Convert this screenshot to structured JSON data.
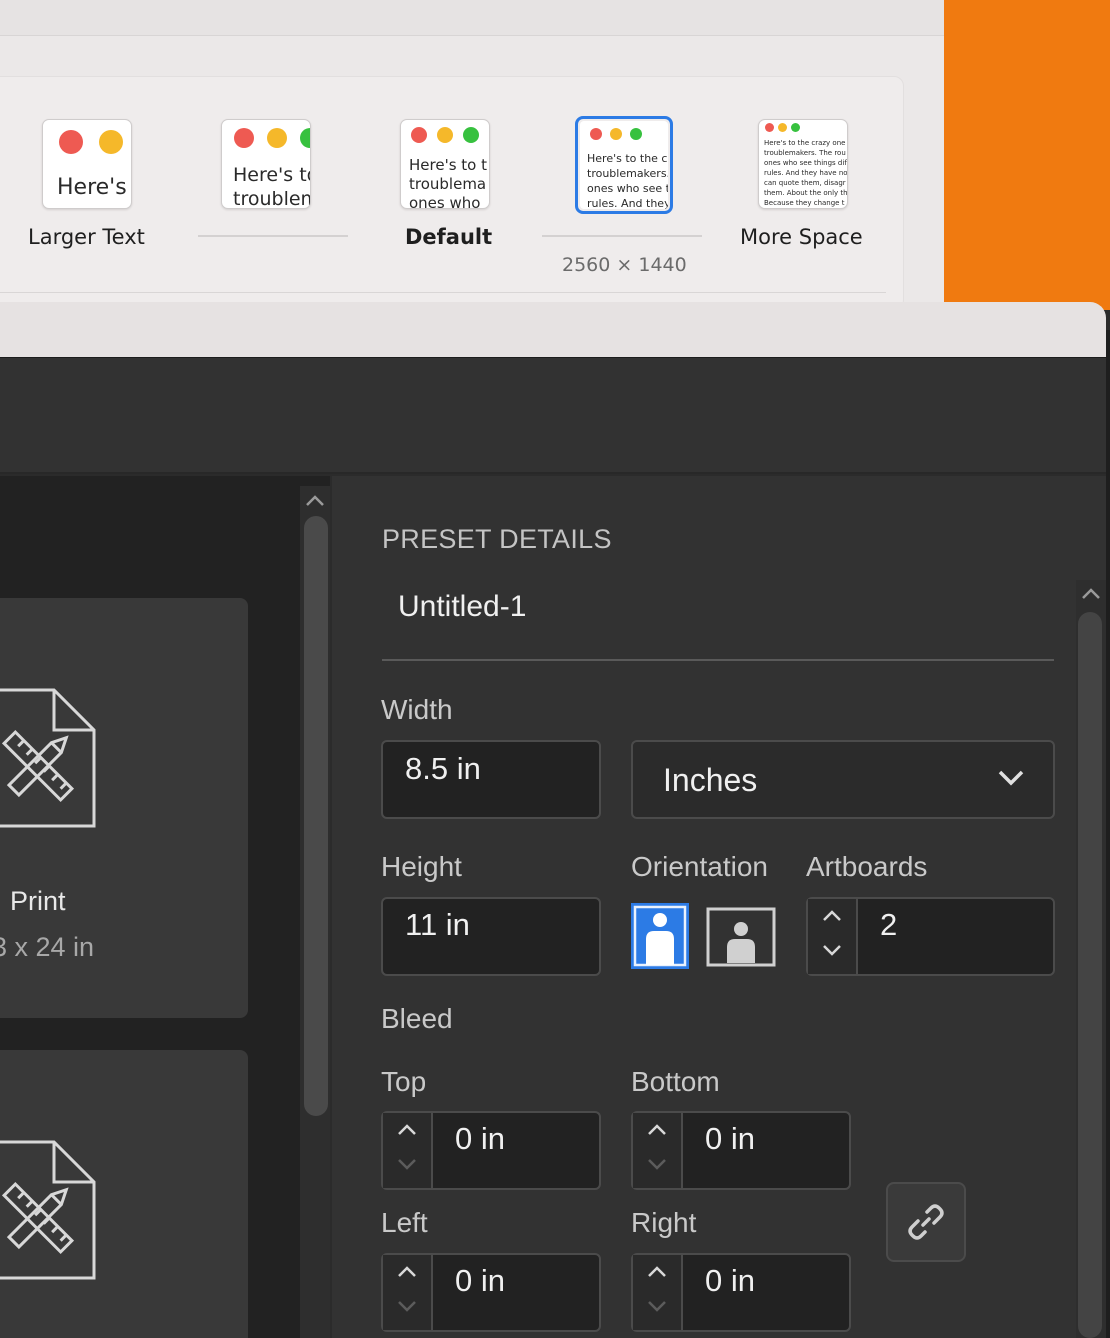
{
  "display_settings": {
    "options": [
      {
        "label": "Larger Text",
        "preview_text": "Here's"
      },
      {
        "label": "",
        "preview_text": "Here's to\ntroublem"
      },
      {
        "label": "Default",
        "preview_text": "Here's to t\ntroublema\nones who"
      },
      {
        "label": "",
        "preview_text": "Here's to the cr\ntroublemakers.\nones who see t\nrules. And they",
        "selected": true,
        "resolution": "2560 × 1440"
      },
      {
        "label": "More Space",
        "preview_text": "Here's to the crazy one\ntroublemakers. The rou\nones who see things dif\nrules. And they have no\ncan quote them, disagr\nthem. About the only th\nBecause they change t"
      }
    ],
    "colors": {
      "accent": "#2c7be5",
      "desktop": "#f07a10"
    }
  },
  "left_pane": {
    "cards": [
      {
        "title": "Print",
        "subtitle": "3 x 24 in",
        "icon": "document-ruler-pencil-icon"
      },
      {
        "title": "",
        "subtitle": "",
        "icon": "document-ruler-pencil-icon"
      }
    ]
  },
  "preset": {
    "section_title": "PRESET DETAILS",
    "name": "Untitled-1",
    "width_label": "Width",
    "width_value": "8.5 in",
    "units_value": "Inches",
    "height_label": "Height",
    "height_value": "11 in",
    "orientation_label": "Orientation",
    "artboards_label": "Artboards",
    "artboards_value": "2",
    "bleed_label": "Bleed",
    "top_label": "Top",
    "top_value": "0 in",
    "bottom_label": "Bottom",
    "bottom_value": "0 in",
    "left_label": "Left",
    "left_value": "0 in",
    "right_label": "Right",
    "right_value": "0 in",
    "orientation_selected": "portrait",
    "colors": {
      "accent": "#2c7be5"
    }
  }
}
